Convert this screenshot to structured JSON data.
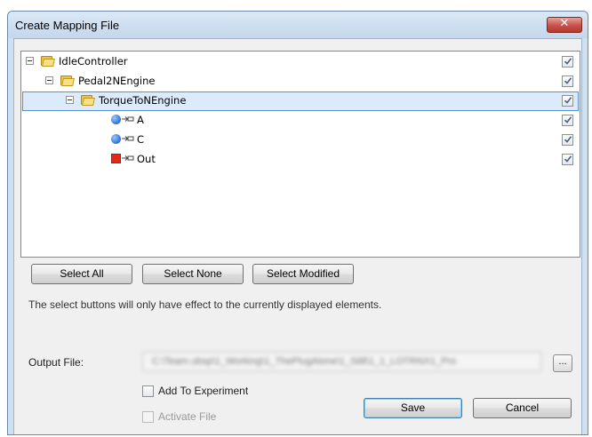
{
  "window": {
    "title": "Create Mapping File",
    "close_icon": "✕"
  },
  "tree": {
    "nodes": [
      {
        "label": "IdleController",
        "type": "folder",
        "expanded": true,
        "checked": true
      },
      {
        "label": "Pedal2NEngine",
        "type": "folder",
        "expanded": true,
        "checked": true
      },
      {
        "label": "TorqueToNEngine",
        "type": "folder",
        "expanded": true,
        "checked": true,
        "selected": true
      },
      {
        "label": "A",
        "type": "input-port",
        "icon": "blue-circle-port-icon",
        "checked": true
      },
      {
        "label": "C",
        "type": "input-port",
        "icon": "blue-circle-port-icon",
        "checked": true
      },
      {
        "label": "Out",
        "type": "output-port",
        "icon": "red-square-port-icon",
        "checked": true
      }
    ]
  },
  "buttons": {
    "select_all": "Select All",
    "select_none": "Select None",
    "select_modified": "Select Modified",
    "save": "Save",
    "cancel": "Cancel",
    "browse": "..."
  },
  "info_text": "The select buttons will only have effect to the currently displayed elements.",
  "output": {
    "label": "Output File:",
    "value": "C:\\Team.ubsp\\1_Working\\1_ThePlugAlone\\1_Still\\1_1_LOTRNX1_Pro"
  },
  "options": {
    "add_to_experiment": {
      "label": "Add To Experiment",
      "checked": false
    },
    "activate_file": {
      "label": "Activate File",
      "checked": false,
      "disabled": true
    }
  },
  "colors": {
    "selection_fill": "#dcebfc",
    "selection_border": "#5d8ed1",
    "close_button": "#c75050",
    "port_input": "#2c6ed8",
    "port_output": "#e02a1c"
  }
}
